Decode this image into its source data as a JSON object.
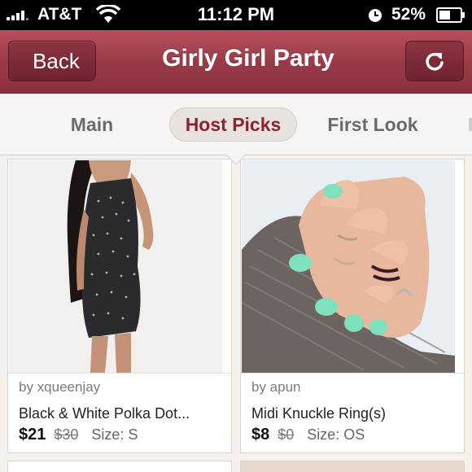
{
  "status_bar": {
    "carrier": "AT&T",
    "time": "11:12 PM",
    "battery_percent": "52%",
    "signal_icon": "signal-bars-icon",
    "wifi_icon": "wifi-icon",
    "clock_icon": "alarm-clock-icon",
    "battery_icon": "battery-icon"
  },
  "nav": {
    "back_label": "Back",
    "title": "Girly Girl Party",
    "refresh_icon": "refresh-icon",
    "bar_color": "#9b3b48"
  },
  "tabs": [
    {
      "label": "Main",
      "active": false
    },
    {
      "label": "Host Picks",
      "active": true
    },
    {
      "label": "First Look",
      "active": false
    }
  ],
  "listings": [
    {
      "seller": "by xqueenjay",
      "title": "Black & White Polka Dot...",
      "price": "$21",
      "original_price": "$30",
      "size": "Size: S"
    },
    {
      "seller": "by apun",
      "title": "Midi Knuckle Ring(s)",
      "price": "$8",
      "original_price": "$0",
      "size": "Size: OS"
    }
  ],
  "colors": {
    "accent": "#8c2332",
    "background": "#f4f1ef"
  }
}
